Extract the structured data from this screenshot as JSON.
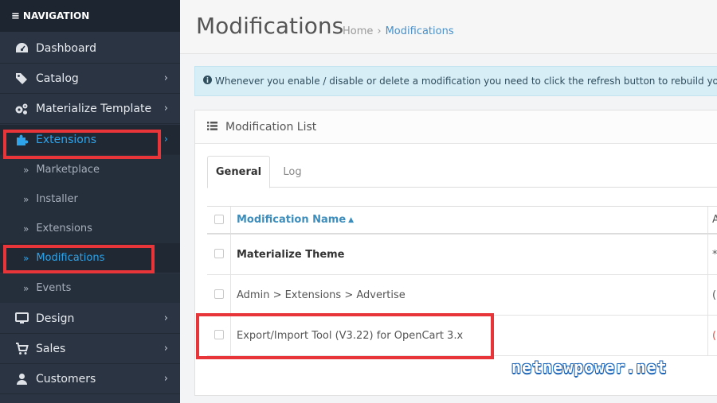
{
  "sidebar": {
    "header": "NAVIGATION",
    "items": [
      {
        "label": "Dashboard",
        "icon": "dashboard-icon"
      },
      {
        "label": "Catalog",
        "icon": "tag-icon"
      },
      {
        "label": "Materialize Template",
        "icon": "cogs-icon"
      },
      {
        "label": "Extensions",
        "icon": "puzzle-icon"
      },
      {
        "label": "Design",
        "icon": "monitor-icon"
      },
      {
        "label": "Sales",
        "icon": "cart-icon"
      },
      {
        "label": "Customers",
        "icon": "user-icon"
      }
    ],
    "sub_items": [
      {
        "label": "Marketplace"
      },
      {
        "label": "Installer"
      },
      {
        "label": "Extensions"
      },
      {
        "label": "Modifications"
      },
      {
        "label": "Events"
      }
    ]
  },
  "header": {
    "title": "Modifications",
    "breadcrumb_home": "Home",
    "breadcrumb_current": "Modifications"
  },
  "alert": {
    "text": "Whenever you enable / disable or delete a modification you need to click the refresh button to rebuild your modification cache!"
  },
  "panel": {
    "title": "Modification List",
    "tabs": [
      {
        "label": "General"
      },
      {
        "label": "Log"
      }
    ],
    "table": {
      "header": "Modification Name",
      "rows": [
        {
          "name": "Materialize Theme",
          "extra": "*"
        },
        {
          "name": "Admin > Extensions > Advertise",
          "extra": "("
        },
        {
          "name": "Export/Import Tool (V3.22) for OpenCart 3.x",
          "extra": "("
        }
      ]
    }
  },
  "watermark": "netnewpower.net",
  "colors": {
    "sidebar_bg": "#2a3443",
    "active_blue": "#2ea4ea",
    "highlight_red": "#e8353a"
  }
}
